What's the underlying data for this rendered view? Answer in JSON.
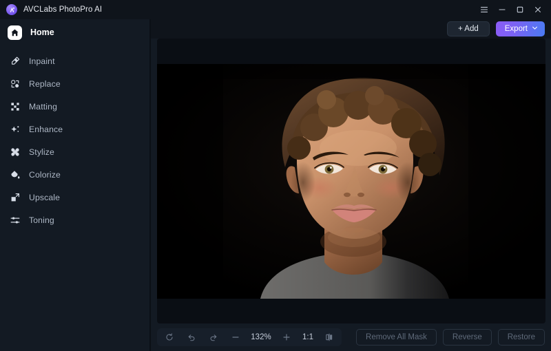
{
  "window": {
    "app_title": "AVCLabs PhotoPro AI",
    "logo_icon": "avclabs-logo-icon",
    "controls": [
      {
        "name": "menu-icon",
        "label": "Menu"
      },
      {
        "name": "minimize-icon",
        "label": "Minimize"
      },
      {
        "name": "maximize-icon",
        "label": "Maximize"
      },
      {
        "name": "close-icon",
        "label": "Close"
      }
    ]
  },
  "sidebar": {
    "home": {
      "label": "Home",
      "icon": "home-icon"
    },
    "items": [
      {
        "label": "Inpaint",
        "icon": "inpaint-icon"
      },
      {
        "label": "Replace",
        "icon": "replace-icon"
      },
      {
        "label": "Matting",
        "icon": "matting-icon"
      },
      {
        "label": "Enhance",
        "icon": "enhance-icon"
      },
      {
        "label": "Stylize",
        "icon": "stylize-icon"
      },
      {
        "label": "Colorize",
        "icon": "colorize-icon"
      },
      {
        "label": "Upscale",
        "icon": "upscale-icon"
      },
      {
        "label": "Toning",
        "icon": "toning-icon"
      }
    ]
  },
  "topbar": {
    "add_label": "+ Add",
    "export_label": "Export",
    "export_chevron_icon": "chevron-down-icon",
    "export_gradient_from": "#8b5cf6",
    "export_gradient_to": "#4a7bf2"
  },
  "canvas": {
    "image_alt": "Portrait photo of a young man with curly brown hair on a black background",
    "background_color": "#000000"
  },
  "bottombar": {
    "tools": [
      {
        "name": "reset-icon",
        "label": "Reset"
      },
      {
        "name": "undo-icon",
        "label": "Undo"
      },
      {
        "name": "redo-icon",
        "label": "Redo"
      },
      {
        "name": "zoom-out-icon",
        "label": "Zoom out"
      }
    ],
    "zoom_level": "132%",
    "zoom_in_icon": "zoom-in-icon",
    "fit_ratio": "1:1",
    "compare_icon": "compare-split-icon",
    "mask_buttons": [
      {
        "label": "Remove All Mask",
        "enabled": false
      },
      {
        "label": "Reverse",
        "enabled": false
      },
      {
        "label": "Restore",
        "enabled": false
      }
    ]
  }
}
